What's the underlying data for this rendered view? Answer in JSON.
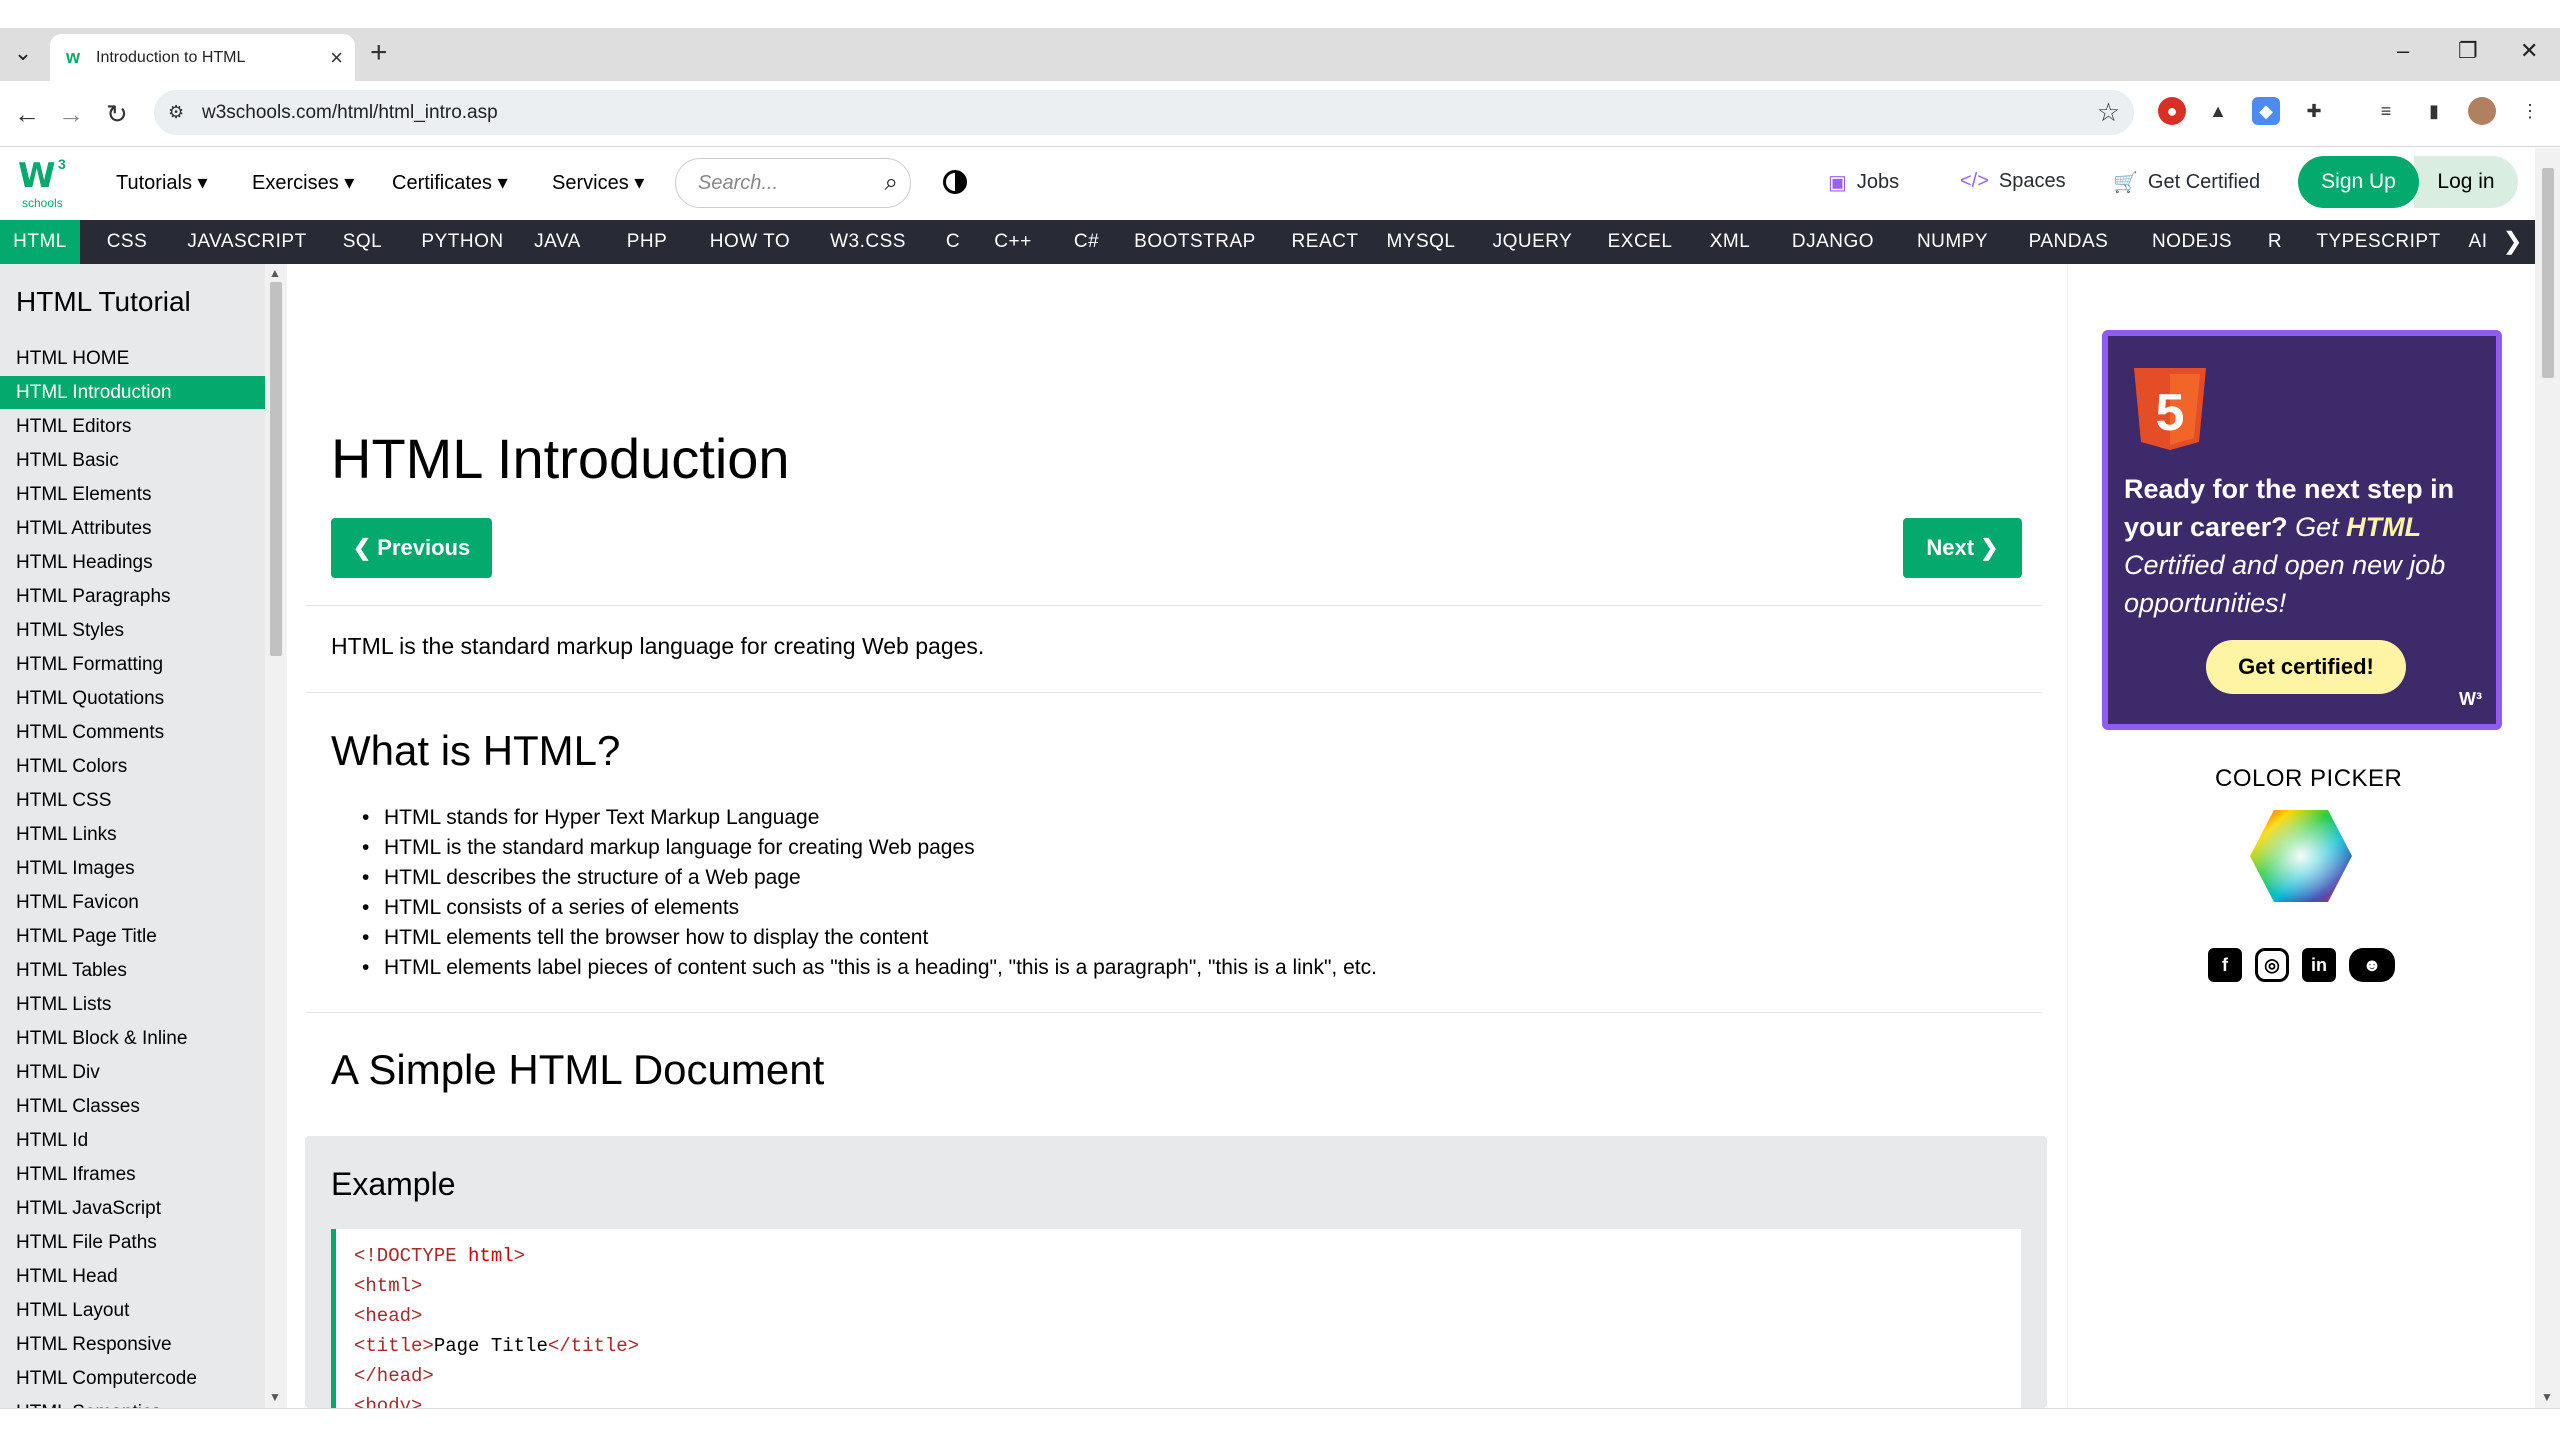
{
  "browser": {
    "tab_title": "Introduction to HTML",
    "url": "w3schools.com/html/html_intro.asp"
  },
  "topnav": {
    "logo_text": "W",
    "logo_sup": "3",
    "logo_sub": "schools",
    "menus": [
      "Tutorials ▾",
      "Exercises ▾",
      "Certificates ▾",
      "Services ▾"
    ],
    "search_placeholder": "Search...",
    "jobs": "Jobs",
    "spaces": "Spaces",
    "get_certified": "Get Certified",
    "signup": "Sign Up",
    "login": "Log in"
  },
  "subjects": [
    "HTML",
    "CSS",
    "JAVASCRIPT",
    "SQL",
    "PYTHON",
    "JAVA",
    "PHP",
    "HOW TO",
    "W3.CSS",
    "C",
    "C++",
    "C#",
    "BOOTSTRAP",
    "REACT",
    "MYSQL",
    "JQUERY",
    "EXCEL",
    "XML",
    "DJANGO",
    "NUMPY",
    "PANDAS",
    "NODEJS",
    "R",
    "TYPESCRIPT",
    "AI"
  ],
  "sidebar": {
    "title": "HTML Tutorial",
    "items": [
      "HTML HOME",
      "HTML Introduction",
      "HTML Editors",
      "HTML Basic",
      "HTML Elements",
      "HTML Attributes",
      "HTML Headings",
      "HTML Paragraphs",
      "HTML Styles",
      "HTML Formatting",
      "HTML Quotations",
      "HTML Comments",
      "HTML Colors",
      "HTML CSS",
      "HTML Links",
      "HTML Images",
      "HTML Favicon",
      "HTML Page Title",
      "HTML Tables",
      "HTML Lists",
      "HTML Block & Inline",
      "HTML Div",
      "HTML Classes",
      "HTML Id",
      "HTML Iframes",
      "HTML JavaScript",
      "HTML File Paths",
      "HTML Head",
      "HTML Layout",
      "HTML Responsive",
      "HTML Computercode",
      "HTML Semantics"
    ],
    "active_index": 1
  },
  "main": {
    "title": "HTML Introduction",
    "prev_label": "❮ Previous",
    "next_label": "Next ❯",
    "intro": "HTML is the standard markup language for creating Web pages.",
    "what_heading": "What is HTML?",
    "bullets": [
      "HTML stands for Hyper Text Markup Language",
      "HTML is the standard markup language for creating Web pages",
      "HTML describes the structure of a Web page",
      "HTML consists of a series of elements",
      "HTML elements tell the browser how to display the content",
      "HTML elements label pieces of content such as \"this is a heading\", \"this is a paragraph\", \"this is a link\", etc."
    ],
    "simple_heading": "A Simple HTML Document",
    "example_title": "Example"
  },
  "ad": {
    "line1": "Ready for the next step in your career?",
    "line2a": "Get",
    "line2b": "HTML",
    "line3": "Certified and open new job opportunities!",
    "button": "Get certified!",
    "shield_digit": "5"
  },
  "colorpicker": {
    "title": "COLOR PICKER"
  },
  "colors": {
    "accent": "#04AA6D",
    "dark": "#282A35",
    "sidebar": "#E7E9EB",
    "ad_bg": "#3D2A6B",
    "ad_border": "#8F5BF0",
    "ad_btn": "#FFF4A3"
  }
}
